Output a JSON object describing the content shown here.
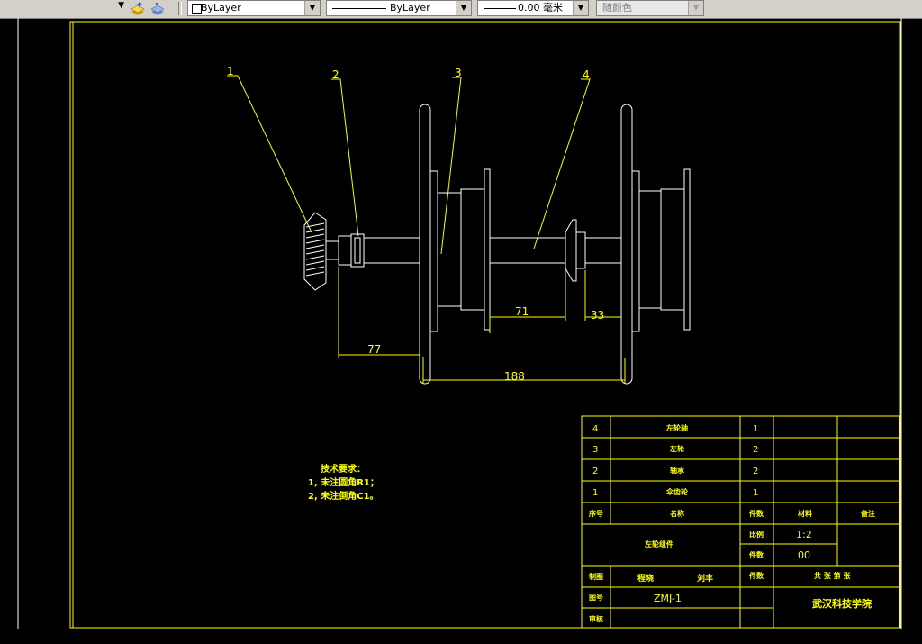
{
  "toolbar": {
    "layer_dropdown_arrow": "▼",
    "color_value": "ByLayer",
    "linetype_value": "ByLayer",
    "lineweight_value": "0.00 毫米",
    "plotstyle_value": "随颜色"
  },
  "drawing": {
    "balloons": [
      "1",
      "2",
      "3",
      "4"
    ],
    "dimensions": [
      "77",
      "188",
      "71",
      "33"
    ],
    "tech_req": {
      "title": "技术要求：",
      "line1": "1, 未注圆角R1；",
      "line2": "2, 未注倒角C1。"
    },
    "bom": [
      {
        "no": "4",
        "name": "左轮轴",
        "qty": "1"
      },
      {
        "no": "3",
        "name": "左轮",
        "qty": "2"
      },
      {
        "no": "2",
        "name": "轴承",
        "qty": "2"
      },
      {
        "no": "1",
        "name": "伞齿轮",
        "qty": "1"
      }
    ],
    "bom_header": {
      "no": "序号",
      "name": "名称",
      "qty": "件数",
      "material": "材料",
      "note": "备注"
    },
    "title_block": {
      "assembly_name": "左轮组件",
      "scale_label": "比例",
      "scale_value": "1:2",
      "num_label": "件数",
      "num_value": "00",
      "draw_label": "制图",
      "drawer": "程晓",
      "drawer2": "刘丰",
      "weight_label": "件数",
      "sheets": "共 张 第 张",
      "drawing_no_label": "图号",
      "drawing_no": "ZMJ-1",
      "review_label": "审核",
      "school": "武汉科技学院"
    }
  },
  "colors": {
    "line": "#ffff00",
    "white": "#ffffff",
    "bg": "#000000"
  }
}
